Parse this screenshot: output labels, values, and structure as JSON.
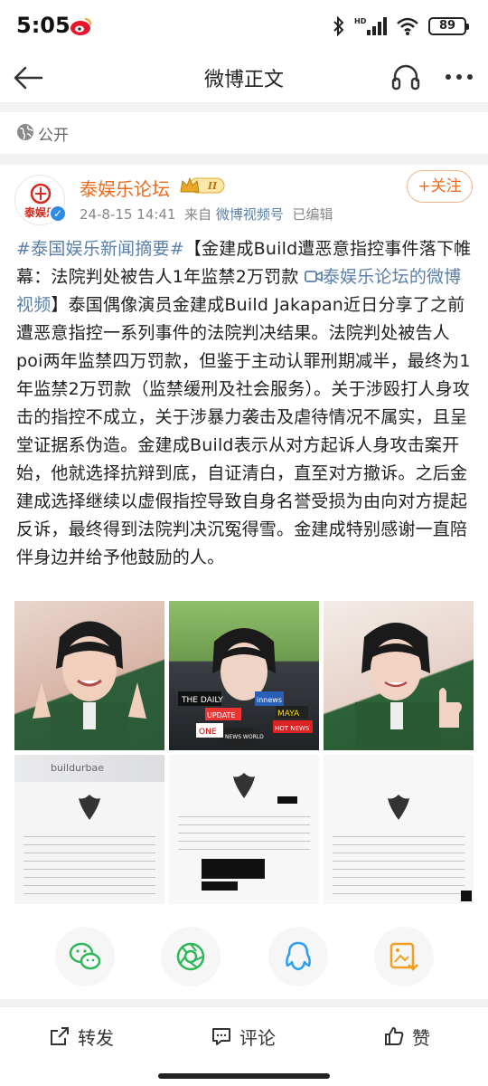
{
  "status": {
    "time": "5:05",
    "battery": "89",
    "network": "HD"
  },
  "nav": {
    "title": "微博正文"
  },
  "post": {
    "visibility": "公开",
    "author": "泰娱乐论坛",
    "avatar_text": "泰娱乐",
    "level": "II",
    "date": "24-8-15 14:41",
    "source_prefix": "来自",
    "source": "微博视频号",
    "edited": "已编辑",
    "follow": "+关注",
    "hashtag": "#泰国娱乐新闻摘要#",
    "text1": "【金建成Build遭恶意指控事件落下帷幕：法院判处被告人1年监禁2万罚款",
    "video_link": "泰娱乐论坛的微博视频",
    "text2": "】泰国偶像演员金建成Build Jakapan近日分享了之前遭恶意指控一系列事件的法院判决结果。法院判处被告人poi两年监禁四万罚款，但鉴于主动认罪刑期减半，最终为1年监禁2万罚款（监禁缓刑及社会服务）。关于涉殴打人身攻击的指控不成立，关于涉暴力袭击及虐待情况不属实，且呈堂证据系伪造。金建成Build表示从对方起诉人身攻击案开始，他就选择抗辩到底，自证清白，直至对方撤诉。之后金建成选择继续以虚假指控导致自身名誉受损为由向对方提起反诉，最终得到法院判决沉冤得雪。金建成特别感谢一直陪伴身边并给予他鼓励的人。",
    "doc_header": "buildurbae",
    "mic_labels": [
      "THE DAILY",
      "UPDATE",
      "ONE",
      "MAYA",
      "HOT NEWS",
      "NEWS WORLD",
      "innews"
    ]
  },
  "share": {
    "icons": [
      "wechat-icon",
      "moments-icon",
      "qq-icon",
      "save-image-icon"
    ]
  },
  "actions": {
    "repost": "转发",
    "comment": "评论",
    "like": "赞"
  },
  "colors": {
    "accent": "#e86b1f",
    "link": "#5a7fa8",
    "wechat": "#2fb75a",
    "qq": "#2a9df4",
    "save": "#f0a020"
  }
}
